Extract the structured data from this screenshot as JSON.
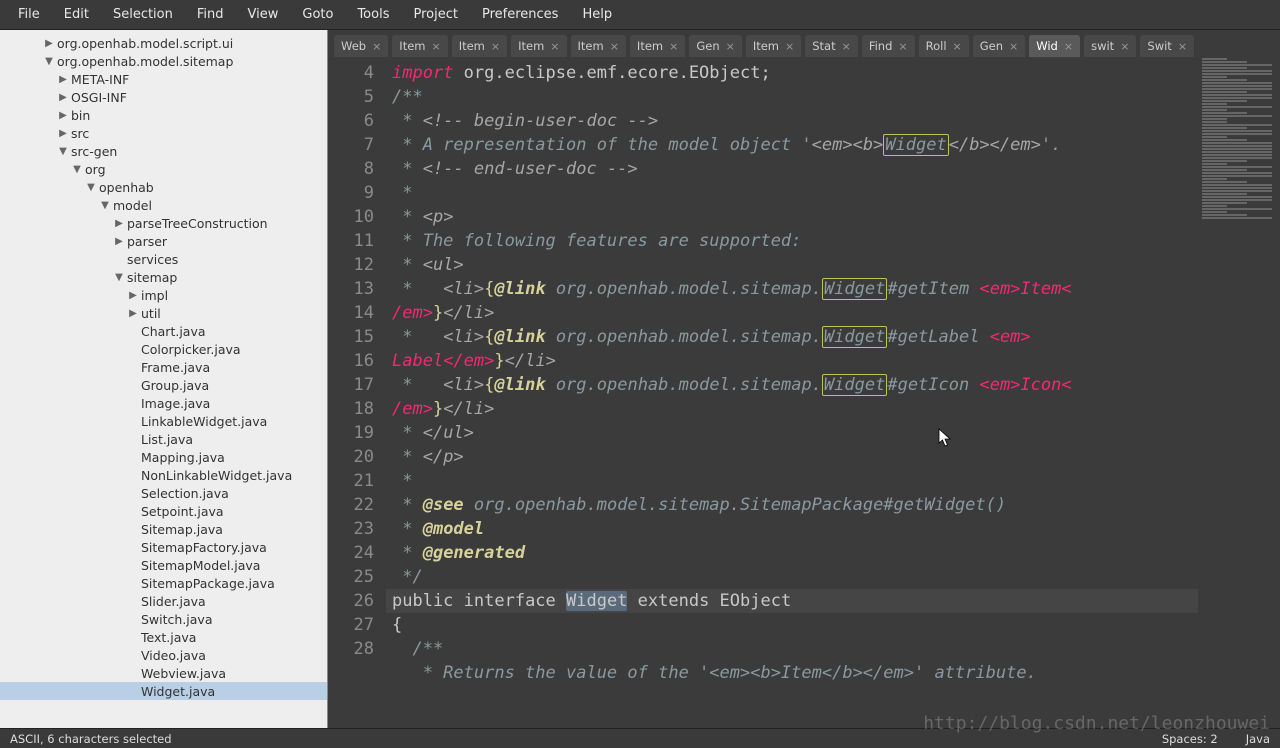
{
  "menu": [
    "File",
    "Edit",
    "Selection",
    "Find",
    "View",
    "Goto",
    "Tools",
    "Project",
    "Preferences",
    "Help"
  ],
  "sidebar": {
    "items": [
      {
        "twist": "▶",
        "label": "org.openhab.model.script.ui",
        "ind": "ind1"
      },
      {
        "twist": "▼",
        "label": "org.openhab.model.sitemap",
        "ind": "ind1"
      },
      {
        "twist": "▶",
        "label": "META-INF",
        "ind": "ind2"
      },
      {
        "twist": "▶",
        "label": "OSGI-INF",
        "ind": "ind2"
      },
      {
        "twist": "▶",
        "label": "bin",
        "ind": "ind2"
      },
      {
        "twist": "▶",
        "label": "src",
        "ind": "ind2"
      },
      {
        "twist": "▼",
        "label": "src-gen",
        "ind": "ind2"
      },
      {
        "twist": "▼",
        "label": "org",
        "ind": "ind3"
      },
      {
        "twist": "▼",
        "label": "openhab",
        "ind": "ind4"
      },
      {
        "twist": "▼",
        "label": "model",
        "ind": "ind5"
      },
      {
        "twist": "▶",
        "label": "parseTreeConstruction",
        "ind": "ind6"
      },
      {
        "twist": "▶",
        "label": "parser",
        "ind": "ind6"
      },
      {
        "twist": "",
        "label": "services",
        "ind": "ind6"
      },
      {
        "twist": "▼",
        "label": "sitemap",
        "ind": "ind6"
      },
      {
        "twist": "▶",
        "label": "impl",
        "ind": "ind7"
      },
      {
        "twist": "▶",
        "label": "util",
        "ind": "ind7"
      },
      {
        "twist": "",
        "label": "Chart.java",
        "ind": "ind7"
      },
      {
        "twist": "",
        "label": "Colorpicker.java",
        "ind": "ind7"
      },
      {
        "twist": "",
        "label": "Frame.java",
        "ind": "ind7"
      },
      {
        "twist": "",
        "label": "Group.java",
        "ind": "ind7"
      },
      {
        "twist": "",
        "label": "Image.java",
        "ind": "ind7"
      },
      {
        "twist": "",
        "label": "LinkableWidget.java",
        "ind": "ind7"
      },
      {
        "twist": "",
        "label": "List.java",
        "ind": "ind7"
      },
      {
        "twist": "",
        "label": "Mapping.java",
        "ind": "ind7"
      },
      {
        "twist": "",
        "label": "NonLinkableWidget.java",
        "ind": "ind7"
      },
      {
        "twist": "",
        "label": "Selection.java",
        "ind": "ind7"
      },
      {
        "twist": "",
        "label": "Setpoint.java",
        "ind": "ind7"
      },
      {
        "twist": "",
        "label": "Sitemap.java",
        "ind": "ind7"
      },
      {
        "twist": "",
        "label": "SitemapFactory.java",
        "ind": "ind7"
      },
      {
        "twist": "",
        "label": "SitemapModel.java",
        "ind": "ind7"
      },
      {
        "twist": "",
        "label": "SitemapPackage.java",
        "ind": "ind7"
      },
      {
        "twist": "",
        "label": "Slider.java",
        "ind": "ind7"
      },
      {
        "twist": "",
        "label": "Switch.java",
        "ind": "ind7"
      },
      {
        "twist": "",
        "label": "Text.java",
        "ind": "ind7"
      },
      {
        "twist": "",
        "label": "Video.java",
        "ind": "ind7"
      },
      {
        "twist": "",
        "label": "Webview.java",
        "ind": "ind7"
      },
      {
        "twist": "",
        "label": "Widget.java",
        "ind": "ind7",
        "selected": true
      }
    ]
  },
  "tabs": [
    {
      "label": "Web"
    },
    {
      "label": "Item"
    },
    {
      "label": "Item"
    },
    {
      "label": "Item"
    },
    {
      "label": "Item"
    },
    {
      "label": "Item"
    },
    {
      "label": "Gen"
    },
    {
      "label": "Item"
    },
    {
      "label": "Stat"
    },
    {
      "label": "Find"
    },
    {
      "label": "Roll"
    },
    {
      "label": "Gen"
    },
    {
      "label": "Wid",
      "active": true
    },
    {
      "label": "swit"
    },
    {
      "label": "Swit"
    }
  ],
  "code": {
    "line5_import": "import",
    "line5_rest": " org.eclipse.emf.ecore.EObject;",
    "l7": "/**",
    "l8_a": " * ",
    "l8_b": "<!-- begin-user-doc -->",
    "l9_a": " * A representation of the model object '",
    "l9_em": "<em><b>",
    "l9_w": "Widget",
    "l9_emEnd": "</b></em>",
    "l9_end": "'.",
    "l10_a": " * ",
    "l10_b": "<!-- end-user-doc -->",
    "l11": " *",
    "l12_a": " * ",
    "l12_b": "<p>",
    "l13": " * The following features are supported:",
    "l14_a": " * ",
    "l14_b": "<ul>",
    "l15_a": " *   ",
    "l15_li": "<li>",
    "l15_brace": "{",
    "l15_link": "@link",
    "l15_pkg": " org.openhab.model.sitemap.",
    "l15_w": "Widget",
    "l15_get": "#getItem ",
    "l15_em": "<em>",
    "l15_name": "Item",
    "l15_emEnd": "</em>",
    "l15_close": "}",
    "l15_liEnd": "</li>",
    "l16_get": "#getLabel ",
    "l16_name": "Label",
    "l17_get": "#getIcon ",
    "l17_name": "Icon",
    "l18_a": " * ",
    "l18_b": "</ul>",
    "l19_a": " * ",
    "l19_b": "</p>",
    "l20": " *",
    "l21_a": " * ",
    "l21_see": "@see",
    "l21_rest": " org.openhab.model.sitemap.SitemapPackage#getWidget()",
    "l22_a": " * ",
    "l22_b": "@model",
    "l23_a": " * ",
    "l23_b": "@generated",
    "l24": " */",
    "l25_pub": "public",
    "l25_if": " interface ",
    "l25_w": "Widget",
    "l25_ext": " extends EObject",
    "l26": "{",
    "l27": "  /**",
    "l28": "   * Returns the value of the '<em><b>Item</b></em>' attribute."
  },
  "status": {
    "left": "ASCII, 6 characters selected",
    "spaces": "Spaces: 2",
    "lang": "Java"
  },
  "watermark": "http://blog.csdn.net/leonzhouwei"
}
